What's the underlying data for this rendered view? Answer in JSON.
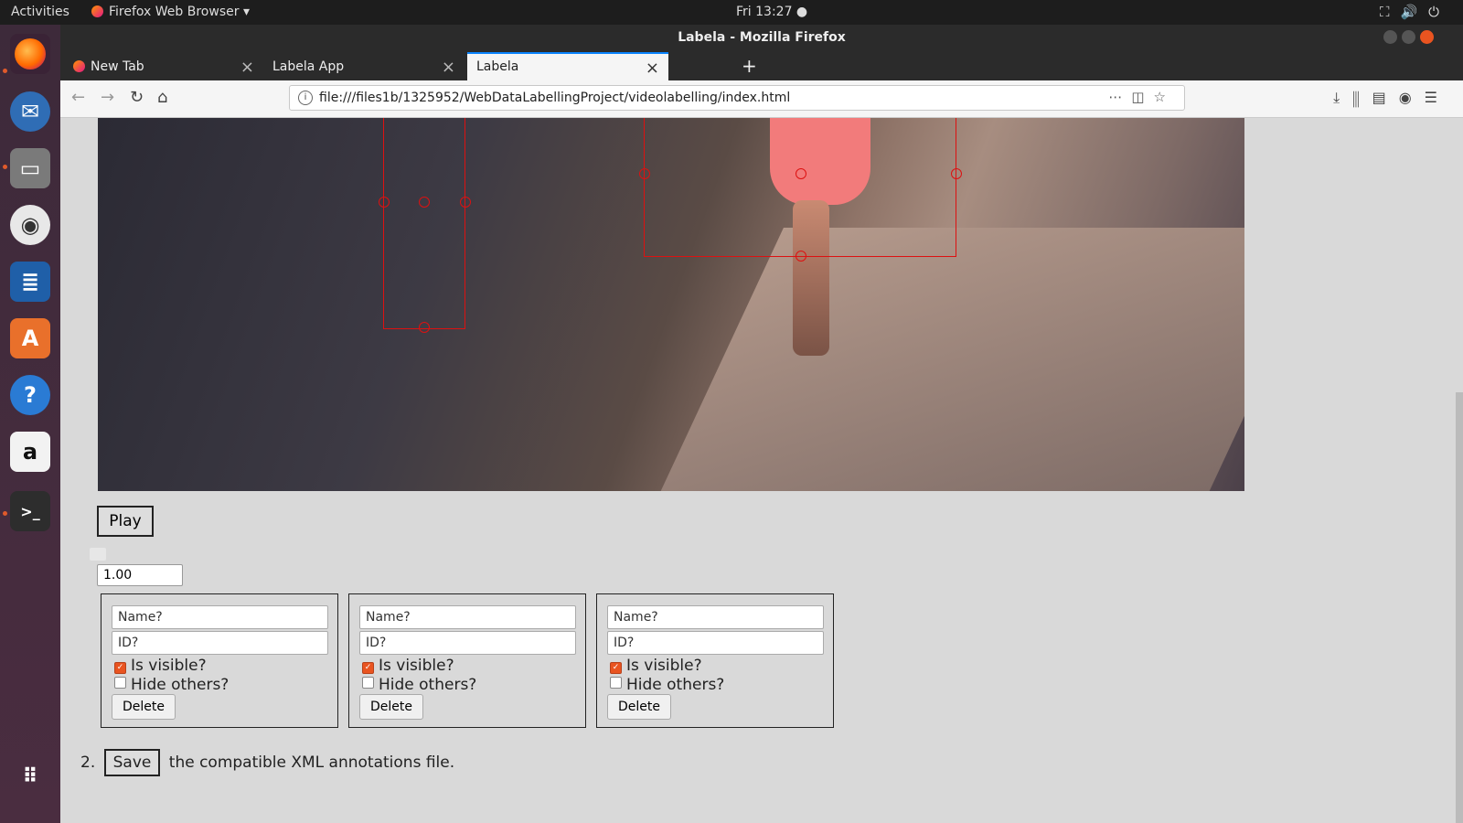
{
  "system": {
    "activities": "Activities",
    "app_menu": "Firefox Web Browser ▾",
    "clock": "Fri 13:27 ●",
    "tray_icons": "network-icon volume-icon power-icon"
  },
  "window": {
    "title": "Labela - Mozilla Firefox"
  },
  "tabs": [
    {
      "label": "New Tab"
    },
    {
      "label": "Labela App"
    },
    {
      "label": "Labela"
    }
  ],
  "navbar": {
    "url": "file:///files1b/1325952/WebDataLabellingProject/videolabelling/index.html"
  },
  "player": {
    "play_label": "Play",
    "speed_value": "1.00"
  },
  "annotations": [
    {
      "name_placeholder": "Name?",
      "id_placeholder": "ID?",
      "visible_label": "Is visible?",
      "visible_checked": true,
      "hide_label": "Hide others?",
      "hide_checked": false,
      "delete_label": "Delete"
    },
    {
      "name_placeholder": "Name?",
      "id_placeholder": "ID?",
      "visible_label": "Is visible?",
      "visible_checked": true,
      "hide_label": "Hide others?",
      "hide_checked": false,
      "delete_label": "Delete"
    },
    {
      "name_placeholder": "Name?",
      "id_placeholder": "ID?",
      "visible_label": "Is visible?",
      "visible_checked": true,
      "hide_label": "Hide others?",
      "hide_checked": false,
      "delete_label": "Delete"
    }
  ],
  "footer": {
    "step_number": "2.",
    "save_label": "Save",
    "save_text": "the compatible XML annotations file."
  },
  "colors": {
    "accent": "#e95420",
    "bbox": "#dd1111",
    "tab_highlight": "#0a84ff"
  }
}
